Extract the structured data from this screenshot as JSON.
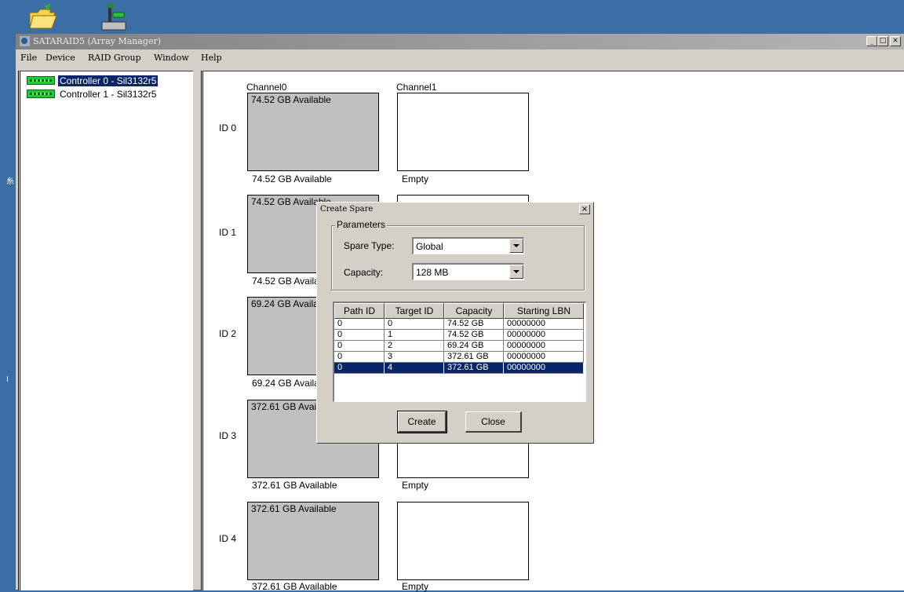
{
  "window": {
    "title": "SATARAID5 (Array Manager)",
    "min": "_",
    "max": "□",
    "close": "×"
  },
  "menu": {
    "file": "File",
    "device": "Device",
    "raid_group": "RAID Group",
    "window": "Window",
    "help": "Help"
  },
  "tree": [
    {
      "label": "Controller 0 - Sil3132r5",
      "selected": true
    },
    {
      "label": "Controller 1 - Sil3132r5",
      "selected": false
    }
  ],
  "channels": [
    "Channel0",
    "Channel1"
  ],
  "ids": [
    "ID 0",
    "ID 1",
    "ID 2",
    "ID 3",
    "ID 4"
  ],
  "disks": [
    {
      "top": "74.52 GB Available",
      "caption": "74.52 GB Available",
      "ch1_caption": "Empty"
    },
    {
      "top": "74.52 GB Available",
      "caption": "74.52 GB Available",
      "ch1_caption": ""
    },
    {
      "top": "69.24 GB Available",
      "caption": "69.24 GB Available",
      "ch1_caption": ""
    },
    {
      "top": "372.61 GB Available",
      "caption": "372.61 GB Available",
      "ch1_caption": "Empty"
    },
    {
      "top": "372.61 GB Available",
      "caption": "372.61 GB Available",
      "ch1_caption": "Empty"
    }
  ],
  "dialog": {
    "title": "Create Spare",
    "close": "×",
    "group_label": "Parameters",
    "spare_type_label": "Spare Type:",
    "spare_type_value": "Global",
    "capacity_label": "Capacity:",
    "capacity_value": "128 MB",
    "columns": [
      "Path ID",
      "Target ID",
      "Capacity",
      "Starting LBN"
    ],
    "rows": [
      [
        "0",
        "0",
        "74.52 GB",
        "00000000"
      ],
      [
        "0",
        "1",
        "74.52 GB",
        "00000000"
      ],
      [
        "0",
        "2",
        "69.24 GB",
        "00000000"
      ],
      [
        "0",
        "3",
        "372.61 GB",
        "00000000"
      ],
      [
        "0",
        "4",
        "372.61 GB",
        "00000000"
      ]
    ],
    "selected_row": 4,
    "create_label": "Create",
    "close_label": "Close"
  },
  "colors": {
    "desktop": "#3a6ea5",
    "selection": "#0a246a",
    "disk_fill": "#c0c0c0"
  }
}
